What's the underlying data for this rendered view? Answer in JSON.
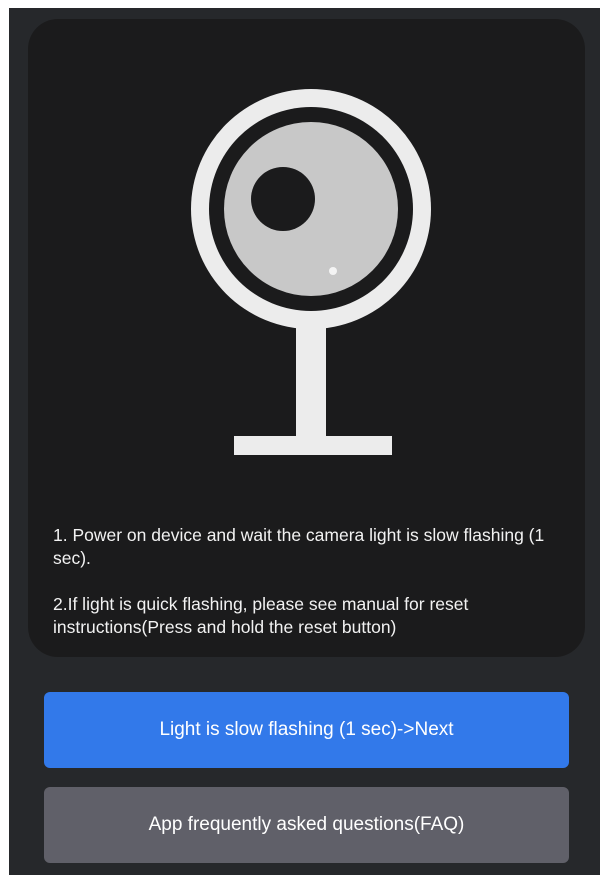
{
  "card": {
    "illustration_icon": "camera-icon",
    "instructions": {
      "step1": "1. Power on device and wait the camera light is slow flashing (1 sec).",
      "step2": "2.If light is quick flashing, please see manual for reset instructions(Press and hold the reset button)"
    }
  },
  "actions": {
    "next_label": "Light is slow flashing (1 sec)->Next",
    "faq_label": "App frequently asked questions(FAQ)"
  },
  "colors": {
    "screen_bg": "#26282b",
    "card_bg": "#1b1b1c",
    "primary": "#3279ea",
    "secondary": "#606069",
    "illustration": "#ececec",
    "lens": "#c8c8c8"
  }
}
